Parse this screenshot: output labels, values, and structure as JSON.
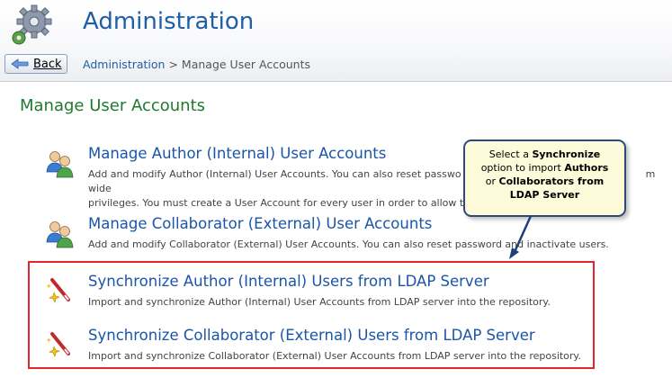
{
  "header": {
    "title": "Administration",
    "back_label": "Back",
    "breadcrumb": {
      "link": "Administration",
      "separator": ">",
      "current": "Manage User Accounts"
    }
  },
  "page_title": "Manage User Accounts",
  "items": [
    {
      "title": "Manage Author (Internal) User Accounts",
      "line1": "Add and modify Author (Internal) User Accounts. You can also reset passwo",
      "line1b": "m wide",
      "line2": "privileges. You must create a User Account for every user in order to allow the",
      "icon": "users-icon"
    },
    {
      "title": "Manage Collaborator (External) User Accounts",
      "line1": "Add and modify Collaborator (External) User Accounts. You can also reset password and inactivate users.",
      "icon": "users-icon"
    },
    {
      "title": "Synchronize Author (Internal) Users from LDAP Server",
      "line1": "Import and synchronize Author (Internal) User Accounts from LDAP server into the repository.",
      "icon": "magic-wand-icon"
    },
    {
      "title": "Synchronize Collaborator (External) Users from LDAP Server",
      "line1": "Import and synchronize Collaborator (External) User Accounts from LDAP server into the repository.",
      "icon": "magic-wand-icon"
    }
  ],
  "callout": {
    "t1": "Select a ",
    "b1": "Synchronize",
    "t2": "option to import ",
    "b2": "Authors",
    "t3": "or ",
    "b3": "Collaborators from",
    "b4": "LDAP Server"
  },
  "colors": {
    "title_blue": "#1f5fa6",
    "page_title_green": "#1f7a2e",
    "highlight_red": "#e0262b"
  }
}
